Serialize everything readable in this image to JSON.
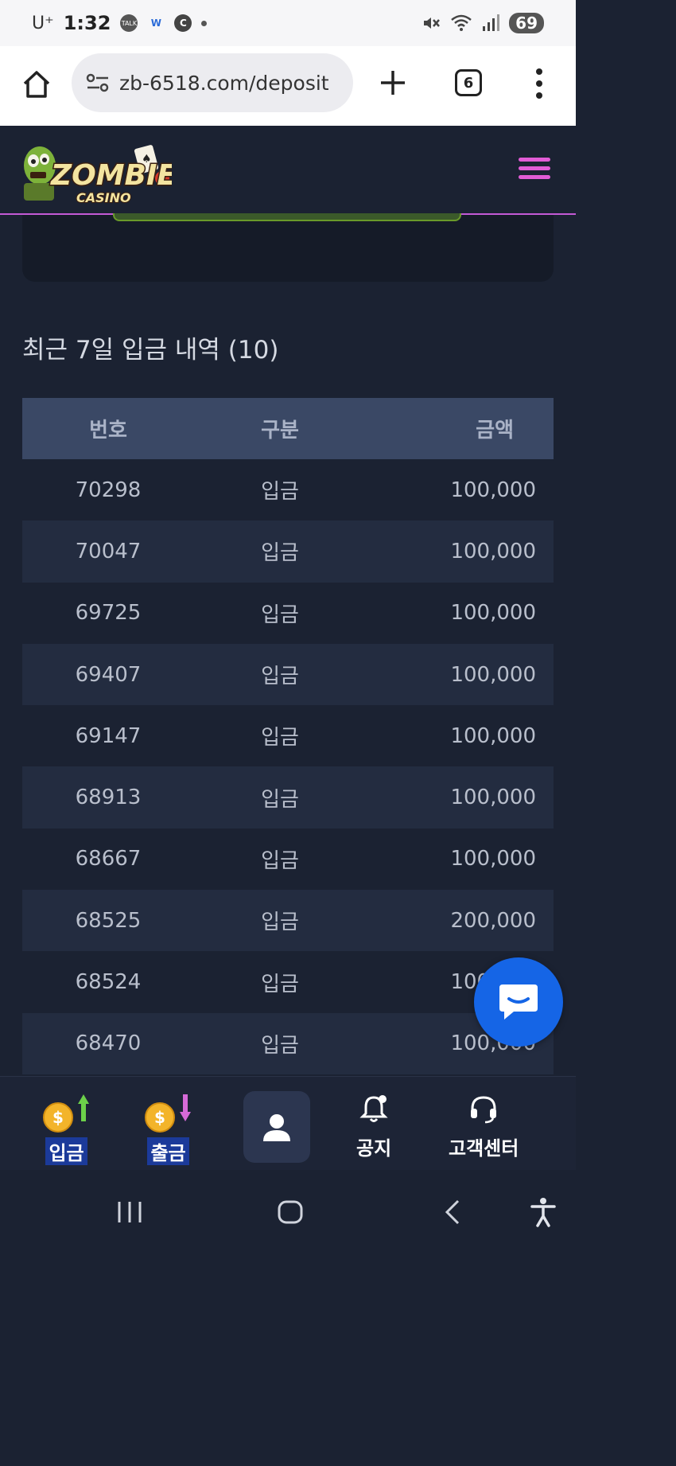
{
  "status_bar": {
    "carrier": "U⁺",
    "time": "1:32",
    "notif_talk": "TALK",
    "notif_w": "W",
    "notif_c": "C",
    "battery": "69"
  },
  "browser": {
    "url": "zb-6518.com/deposit",
    "tab_count": "6"
  },
  "site": {
    "logo_text_main": "ZOMBIE",
    "logo_text_sub": "CASINO",
    "accent_color": "#e25cd6"
  },
  "history": {
    "title": "최근 7일 입금 내역 (10)",
    "columns": [
      "번호",
      "구분",
      "금액"
    ],
    "rows": [
      {
        "id": "70298",
        "type": "입금",
        "amount": "100,000"
      },
      {
        "id": "70047",
        "type": "입금",
        "amount": "100,000"
      },
      {
        "id": "69725",
        "type": "입금",
        "amount": "100,000"
      },
      {
        "id": "69407",
        "type": "입금",
        "amount": "100,000"
      },
      {
        "id": "69147",
        "type": "입금",
        "amount": "100,000"
      },
      {
        "id": "68913",
        "type": "입금",
        "amount": "100,000"
      },
      {
        "id": "68667",
        "type": "입금",
        "amount": "100,000"
      },
      {
        "id": "68525",
        "type": "입금",
        "amount": "200,000"
      },
      {
        "id": "68524",
        "type": "입금",
        "amount": "100,000"
      },
      {
        "id": "68470",
        "type": "입금",
        "amount": "100,000"
      }
    ]
  },
  "bottom_nav": {
    "deposit": "입금",
    "withdraw": "출금",
    "notice": "공지",
    "support": "고객센터",
    "coin_symbol": "$"
  }
}
